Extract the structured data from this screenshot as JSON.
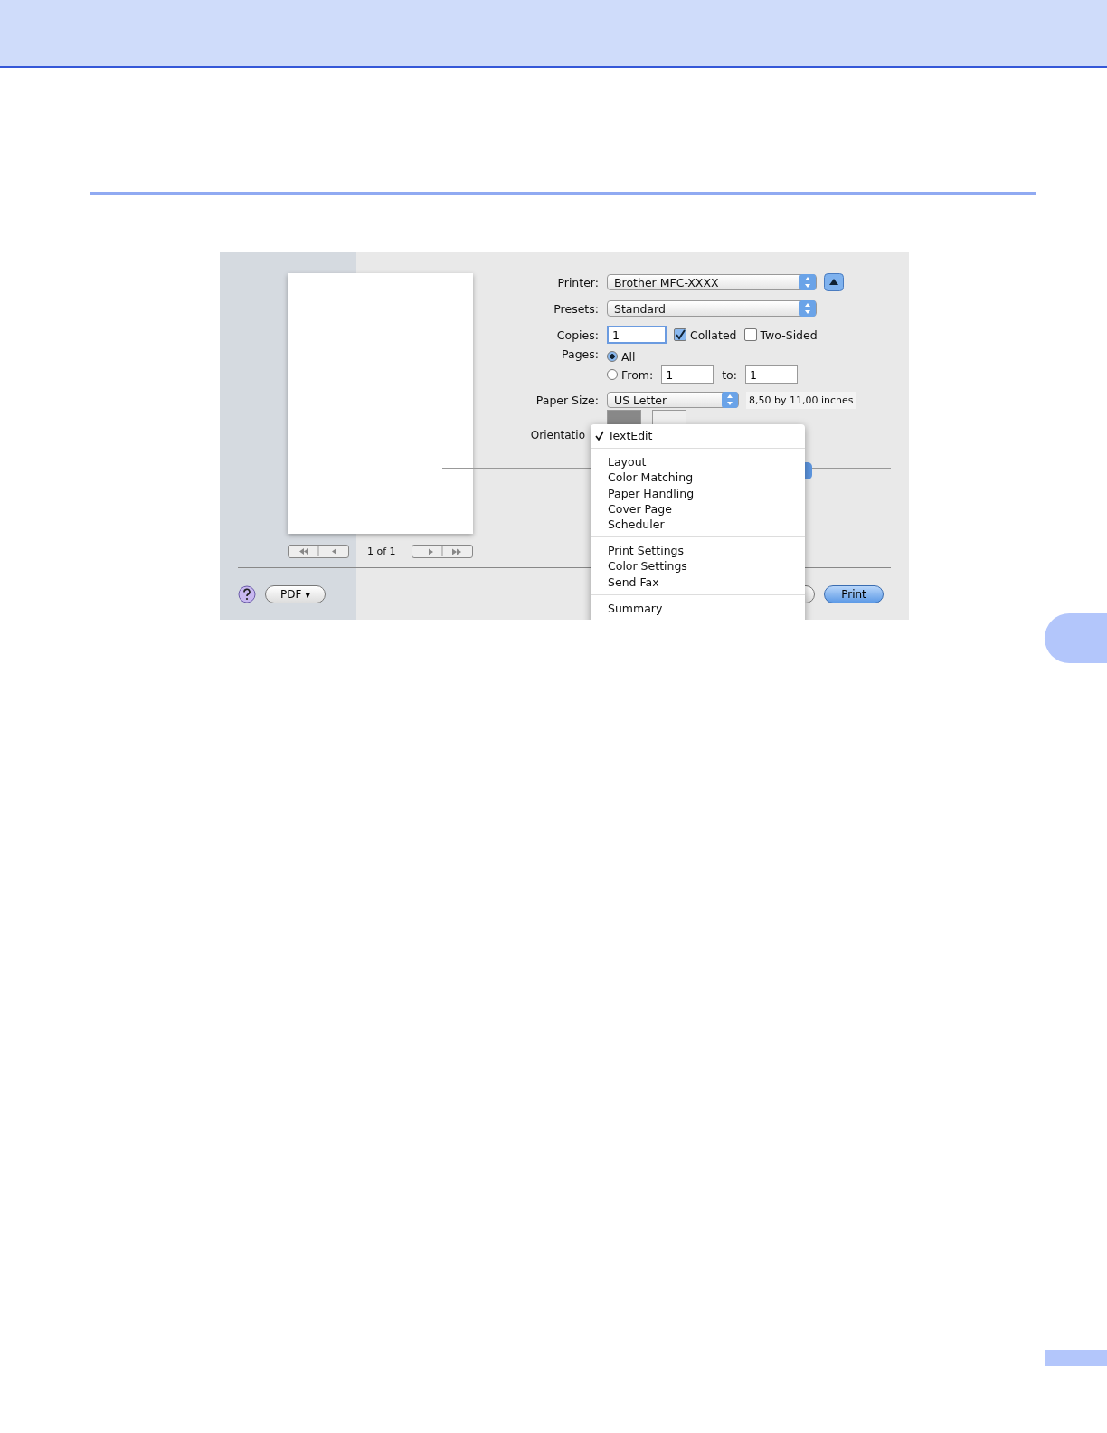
{
  "dialog": {
    "preview": {
      "page_indicator": "1 of 1"
    },
    "printer": {
      "label": "Printer:",
      "value": "Brother MFC-XXXX"
    },
    "presets": {
      "label": "Presets:",
      "value": "Standard"
    },
    "copies": {
      "label": "Copies:",
      "value": "1"
    },
    "collated": {
      "label": "Collated",
      "checked": true
    },
    "two_sided": {
      "label": "Two-Sided",
      "checked": false
    },
    "pages": {
      "label": "Pages:",
      "options": [
        {
          "label": "All",
          "selected": true
        },
        {
          "label": "From:",
          "selected": false
        }
      ],
      "from": "1",
      "to_label": "to:",
      "to": "1"
    },
    "paper_size": {
      "label": "Paper Size:",
      "value": "US Letter",
      "dimensions": "8,50 by 11,00 inches"
    },
    "orientation": {
      "label": "Orientatio"
    },
    "pdf_button": "PDF ▾",
    "print_button": "Print"
  },
  "menu": {
    "groups": [
      [
        {
          "label": "TextEdit",
          "checked": true
        }
      ],
      [
        {
          "label": "Layout",
          "checked": false
        },
        {
          "label": "Color Matching",
          "checked": false
        },
        {
          "label": "Paper Handling",
          "checked": false
        },
        {
          "label": "Cover Page",
          "checked": false
        },
        {
          "label": "Scheduler",
          "checked": false
        }
      ],
      [
        {
          "label": "Print Settings",
          "checked": false
        },
        {
          "label": "Color Settings",
          "checked": false
        },
        {
          "label": "Send Fax",
          "checked": false
        }
      ],
      [
        {
          "label": "Summary",
          "checked": false
        }
      ]
    ]
  }
}
